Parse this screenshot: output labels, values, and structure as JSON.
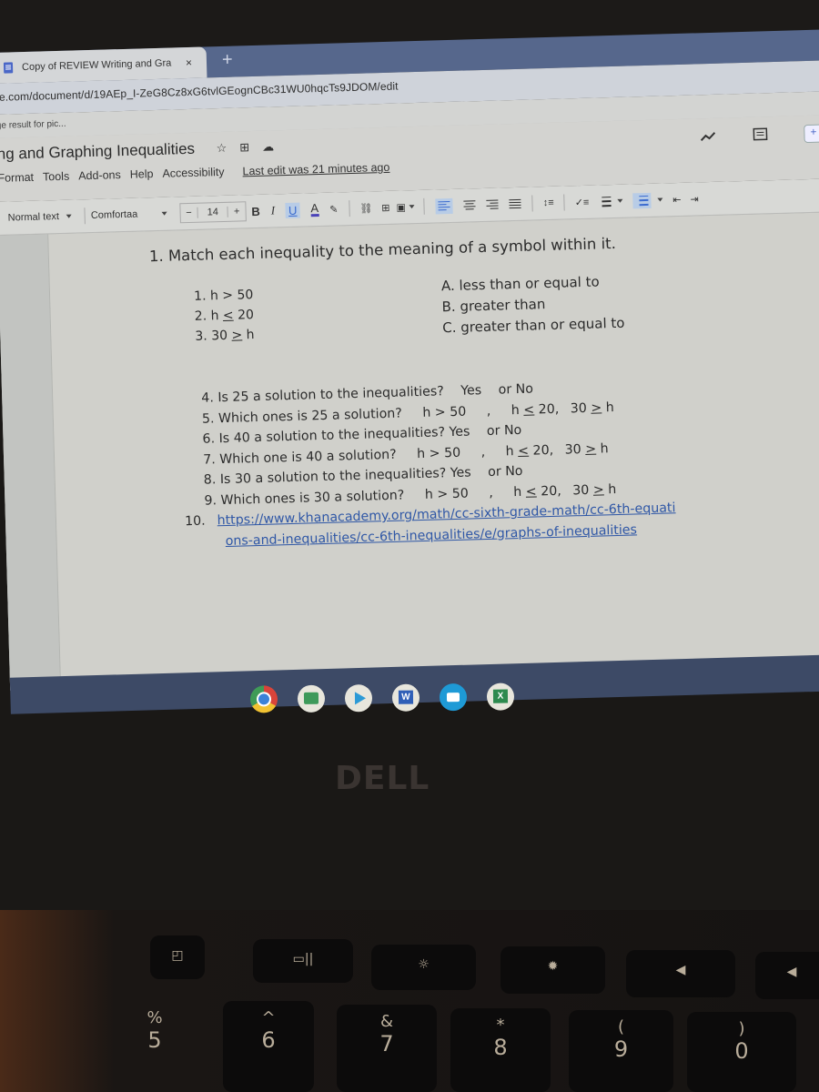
{
  "browser": {
    "tab_title": "Copy of REVIEW Writing and Gra",
    "tab_close": "×",
    "new_tab": "+",
    "url": "e.com/document/d/19AEp_I-ZeG8Cz8xG6tvlGEognCBc31WU0hqcTs9JDOM/edit",
    "bookmark": "ge result for pic..."
  },
  "docs": {
    "title": "ng and Graphing Inequalities",
    "title_icons": [
      "star-icon",
      "move-to-folder-icon",
      "cloud-saved-icon"
    ],
    "menu": [
      "Format",
      "Tools",
      "Add-ons",
      "Help",
      "Accessibility"
    ],
    "last_edit": "Last edit was 21 minutes ago",
    "toolbar": {
      "style": "Normal text",
      "font": "Comfortaa",
      "font_size_minus": "−",
      "font_size": "14",
      "font_size_plus": "+",
      "bold": "B",
      "italic": "I",
      "underline": "U",
      "text_color": "A",
      "accent_color": "#3b6bcf",
      "text_color_value": "#4b43b8"
    }
  },
  "document": {
    "q1": "1. Match each inequality to the meaning of a symbol within it.",
    "inequalities": [
      {
        "num": "1.",
        "pre": "h > 50",
        "sym": "",
        "post": ""
      },
      {
        "num": "2.",
        "pre": "h ",
        "sym": "<",
        "post": " 20"
      },
      {
        "num": "3.",
        "pre": "30 ",
        "sym": ">",
        "post": " h"
      }
    ],
    "meanings": [
      "A.  less than or equal to",
      "B.  greater than",
      "C.  greater than or equal to"
    ],
    "questions": [
      {
        "num": "4.",
        "text": "Is 25 a solution to the  inequalities?",
        "yes": "Yes",
        "or": "or",
        "no": "No"
      },
      {
        "num": "5.",
        "text": "Which ones is 25 a solution?"
      },
      {
        "num": "6.",
        "text": "Is 40 a solution to the inequalities?",
        "yes": "Yes",
        "or": "or",
        "no": "No"
      },
      {
        "num": "7.",
        "text": "Which one is 40 a solution?"
      },
      {
        "num": "8.",
        "text": "Is 30 a solution to the inequalities?",
        "yes": "Yes",
        "or": "or",
        "no": "No"
      },
      {
        "num": "9.",
        "text": "Which ones is 30 a solution?"
      }
    ],
    "choices": {
      "a": "h > 50",
      "sep": ",",
      "b_pre": "h ",
      "b_sym": "<",
      "b_post": " 20,",
      "c_pre": "30 ",
      "c_sym": ">",
      "c_post": " h"
    },
    "link_num": "10.",
    "link": "https://www.khanacademy.org/math/cc-sixth-grade-math/cc-6th-equations-and-inequalities/cc-6th-inequalities/e/graphs-of-inequalities"
  },
  "shelf": {
    "apps": [
      "Chrome",
      "Google Classroom",
      "Play Store",
      "Word",
      "Meet",
      "Excel"
    ]
  },
  "laptop": {
    "brand": "DELL",
    "number_keys": [
      {
        "top": "%",
        "bottom": "5"
      },
      {
        "top": "^",
        "bottom": "6"
      },
      {
        "top": "&",
        "bottom": "7"
      },
      {
        "top": "*",
        "bottom": "8"
      },
      {
        "top": "(",
        "bottom": "9"
      },
      {
        "top": ")",
        "bottom": "0"
      }
    ],
    "function_keys": [
      "overview-icon",
      "window-switch-icon",
      "brightness-down-icon",
      "brightness-up-icon",
      "volume-mute-icon",
      "volume-down-icon"
    ]
  }
}
